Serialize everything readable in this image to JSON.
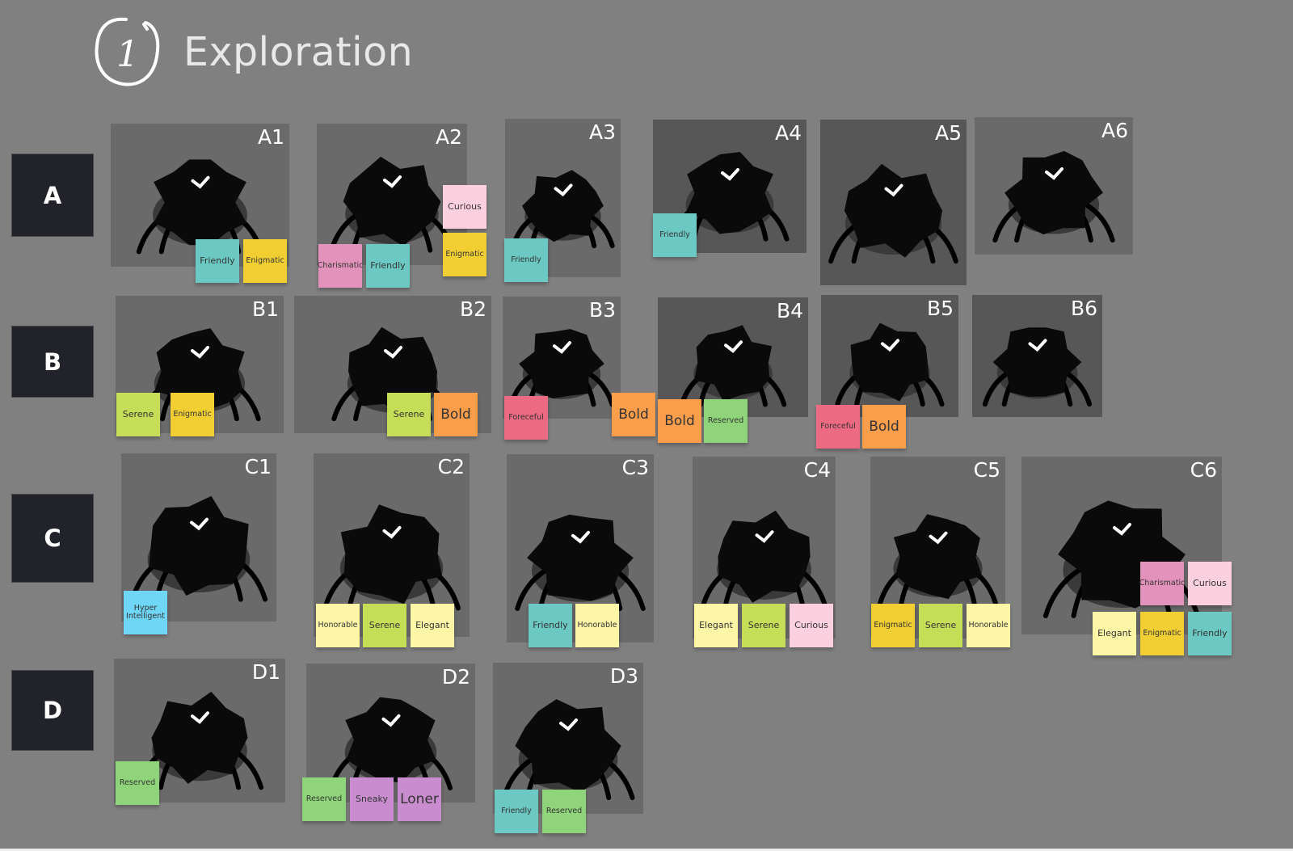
{
  "board": {
    "section_number": "1",
    "title": "Exploration"
  },
  "colors": {
    "background": "#808080",
    "row_label_bg": "#22232a",
    "Friendly": "#6cc8c2",
    "Enigmatic": "#f1cf33",
    "Curious": "#fcd0de",
    "Charismatic": "#e393bb",
    "Serene": "#c6dd58",
    "Bold": "#fb9e4b",
    "Foreceful": "#ec6a82",
    "Reserved": "#8fd47a",
    "Honorable": "#fcf6a6",
    "Elegant": "#fcf6a6",
    "Hyper Intelligent": "#6fd6f6",
    "Sneaky": "#c98dcf",
    "Loner": "#c98dcf"
  },
  "rows": [
    {
      "label": "A"
    },
    {
      "label": "B"
    },
    {
      "label": "C"
    },
    {
      "label": "D"
    }
  ],
  "cards": [
    {
      "code": "A1",
      "tags": [
        "Friendly",
        "Enigmatic"
      ]
    },
    {
      "code": "A2",
      "tags": [
        "Curious",
        "Enigmatic",
        "Charismatic",
        "Friendly"
      ]
    },
    {
      "code": "A3",
      "tags": [
        "Friendly"
      ]
    },
    {
      "code": "A4",
      "tags": [
        "Friendly"
      ]
    },
    {
      "code": "A5",
      "tags": []
    },
    {
      "code": "A6",
      "tags": []
    },
    {
      "code": "B1",
      "tags": [
        "Serene",
        "Enigmatic"
      ]
    },
    {
      "code": "B2",
      "tags": [
        "Serene",
        "Bold"
      ]
    },
    {
      "code": "B3",
      "tags": [
        "Foreceful",
        "Bold"
      ]
    },
    {
      "code": "B4",
      "tags": [
        "Bold",
        "Reserved"
      ]
    },
    {
      "code": "B5",
      "tags": [
        "Foreceful",
        "Bold"
      ]
    },
    {
      "code": "B6",
      "tags": []
    },
    {
      "code": "C1",
      "tags": [
        "Hyper Intelligent"
      ]
    },
    {
      "code": "C2",
      "tags": [
        "Honorable",
        "Serene",
        "Elegant"
      ]
    },
    {
      "code": "C3",
      "tags": [
        "Friendly",
        "Honorable"
      ]
    },
    {
      "code": "C4",
      "tags": [
        "Elegant",
        "Serene",
        "Curious"
      ]
    },
    {
      "code": "C5",
      "tags": [
        "Enigmatic",
        "Serene",
        "Honorable"
      ]
    },
    {
      "code": "C6",
      "tags": [
        "Charismatic",
        "Curious",
        "Elegant",
        "Enigmatic",
        "Friendly"
      ]
    },
    {
      "code": "D1",
      "tags": [
        "Reserved"
      ]
    },
    {
      "code": "D2",
      "tags": [
        "Reserved",
        "Sneaky",
        "Loner"
      ]
    },
    {
      "code": "D3",
      "tags": [
        "Friendly",
        "Reserved"
      ]
    }
  ]
}
